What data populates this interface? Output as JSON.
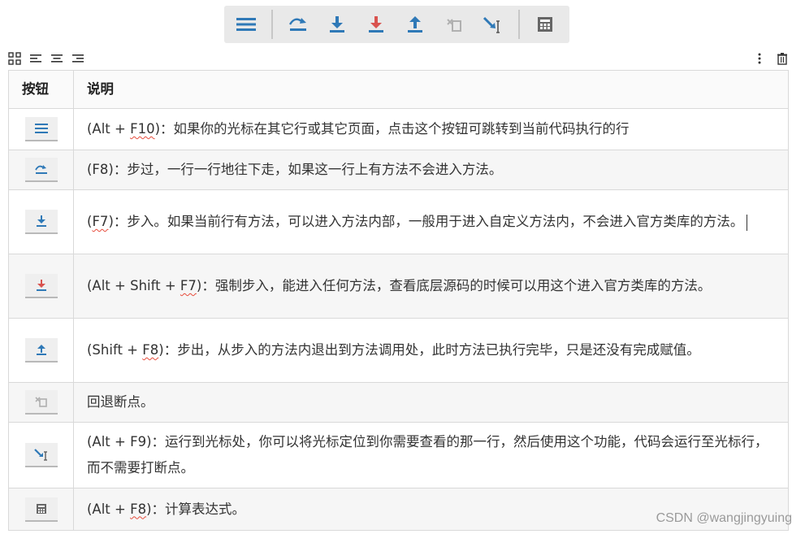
{
  "toolbar": {
    "buttons": [
      {
        "icon": "show-execution-point-icon"
      },
      {
        "icon": "step-over-icon"
      },
      {
        "icon": "step-into-icon"
      },
      {
        "icon": "force-step-into-icon"
      },
      {
        "icon": "step-out-icon"
      },
      {
        "icon": "drop-frame-icon"
      },
      {
        "icon": "run-to-cursor-icon"
      },
      {
        "icon": "evaluate-expression-icon"
      }
    ]
  },
  "table": {
    "headers": [
      "按钮",
      "说明"
    ],
    "rows": [
      {
        "icon": "show-execution-point-icon",
        "desc_prefix": "(Alt + ",
        "desc_key": "F10",
        "desc_suffix": ")：如果你的光标在其它行或其它页面，点击这个按钮可跳转到当前代码执行的行"
      },
      {
        "icon": "step-over-icon",
        "desc_prefix": "(F8)：步过，一行一行地往下走，如果这一行上有方法不会进入方法。",
        "desc_key": "",
        "desc_suffix": ""
      },
      {
        "icon": "step-into-icon",
        "desc_prefix": "(",
        "desc_key": "F7",
        "desc_suffix": ")：步入。如果当前行有方法，可以进入方法内部，一般用于进入自定义方法内，不会进入官方类库的方法。"
      },
      {
        "icon": "force-step-into-icon",
        "desc_prefix": "(Alt + Shift + ",
        "desc_key": "F7",
        "desc_suffix": ")：强制步入，能进入任何方法，查看底层源码的时候可以用这个进入官方类库的方法。"
      },
      {
        "icon": "step-out-icon",
        "desc_prefix": "(Shift + ",
        "desc_key": "F8",
        "desc_suffix": ")：步出，从步入的方法内退出到方法调用处，此时方法已执行完毕，只是还没有完成赋值。"
      },
      {
        "icon": "drop-frame-icon",
        "desc_prefix": "回退断点。",
        "desc_key": "",
        "desc_suffix": ""
      },
      {
        "icon": "run-to-cursor-icon",
        "desc_prefix": "(Alt + F9)：运行到光标处，你可以将光标定位到你需要查看的那一行，然后使用这个功能，代码会运行至光标行，而不需要打断点。",
        "desc_key": "",
        "desc_suffix": ""
      },
      {
        "icon": "evaluate-expression-icon",
        "desc_prefix": "(Alt + ",
        "desc_key": "F8",
        "desc_suffix": ")：计算表达式。"
      }
    ]
  },
  "watermark": "CSDN @wangjingyuing"
}
